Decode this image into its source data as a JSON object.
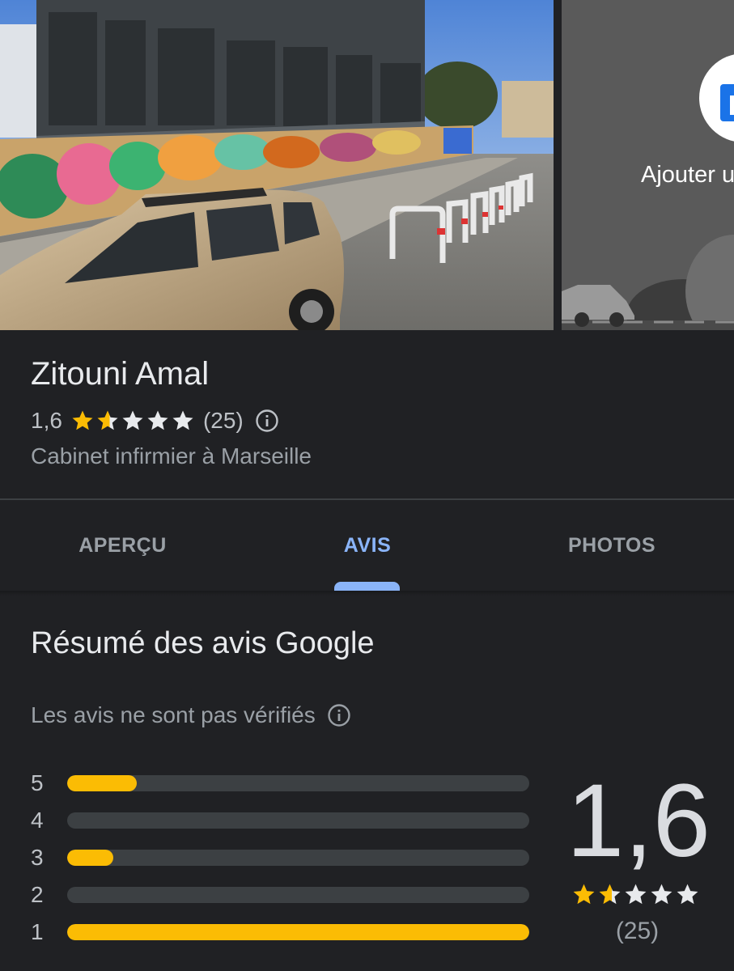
{
  "add_photo": {
    "label": "Ajouter u",
    "icon": "add-photo-icon"
  },
  "place": {
    "name": "Zitouni Amal",
    "rating": "1,6",
    "rating_value": 1.6,
    "max_rating": 5,
    "review_count": "(25)",
    "category": "Cabinet infirmier à Marseille"
  },
  "tabs": [
    {
      "label": "APERÇU",
      "active": false
    },
    {
      "label": "AVIS",
      "active": true
    },
    {
      "label": "PHOTOS",
      "active": false
    }
  ],
  "summary": {
    "title": "Résumé des avis Google",
    "unverified": "Les avis ne sont pas vérifiés",
    "distribution": [
      {
        "stars": "5",
        "fraction": 0.15
      },
      {
        "stars": "4",
        "fraction": 0.0
      },
      {
        "stars": "3",
        "fraction": 0.1
      },
      {
        "stars": "2",
        "fraction": 0.0
      },
      {
        "stars": "1",
        "fraction": 1.0
      }
    ],
    "rating": "1,6",
    "count": "(25)"
  },
  "colors": {
    "background": "#202124",
    "accent": "#8ab4f8",
    "star": "#fbbc04",
    "star_empty": "#e8eaed",
    "bar_track": "#3c4043"
  }
}
